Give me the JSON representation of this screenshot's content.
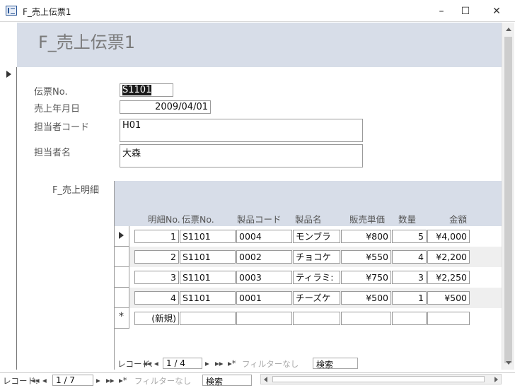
{
  "window": {
    "title": "F_売上伝票1",
    "minimize_glyph": "–",
    "maximize_glyph": "☐",
    "close_glyph": "✕"
  },
  "form": {
    "title": "F_売上伝票1",
    "fields": {
      "slip_no": {
        "label": "伝票No.",
        "value": "S1101"
      },
      "sales_date": {
        "label": "売上年月日",
        "value": "2009/04/01"
      },
      "staff_code": {
        "label": "担当者コード",
        "value": "H01"
      },
      "staff_name": {
        "label": "担当者名",
        "value": "大森"
      }
    },
    "subform_label": "F_売上明細"
  },
  "subform": {
    "columns": [
      "明細No.",
      "伝票No.",
      "製品コード",
      "製品名",
      "販売単価",
      "数量",
      "金額"
    ],
    "rows": [
      {
        "detail_no": "1",
        "slip_no": "S1101",
        "product_code": "0004",
        "product_name": "モンブラ",
        "unit_price": "¥800",
        "qty": "5",
        "amount": "¥4,000"
      },
      {
        "detail_no": "2",
        "slip_no": "S1101",
        "product_code": "0002",
        "product_name": "チョコケ",
        "unit_price": "¥550",
        "qty": "4",
        "amount": "¥2,200"
      },
      {
        "detail_no": "3",
        "slip_no": "S1101",
        "product_code": "0003",
        "product_name": "ティラミ:",
        "unit_price": "¥750",
        "qty": "3",
        "amount": "¥2,250"
      },
      {
        "detail_no": "4",
        "slip_no": "S1101",
        "product_code": "0001",
        "product_name": "チーズケ",
        "unit_price": "¥500",
        "qty": "1",
        "amount": "¥500"
      }
    ],
    "new_row": {
      "detail_no": "(新規)",
      "marker": "*"
    },
    "nav": {
      "label": "レコード:",
      "first": "◂◂",
      "prev": "◂",
      "position": "1 / 4",
      "next": "▸",
      "last": "▸▸",
      "new": "▸*",
      "filter": "フィルターなし",
      "search": "検索"
    }
  },
  "main_nav": {
    "label": "レコード:",
    "first": "◂◂",
    "prev": "◂",
    "position": "1 / 7",
    "next": "▸",
    "last": "▸▸",
    "new": "▸*",
    "filter": "フィルターなし",
    "search": "検索"
  }
}
